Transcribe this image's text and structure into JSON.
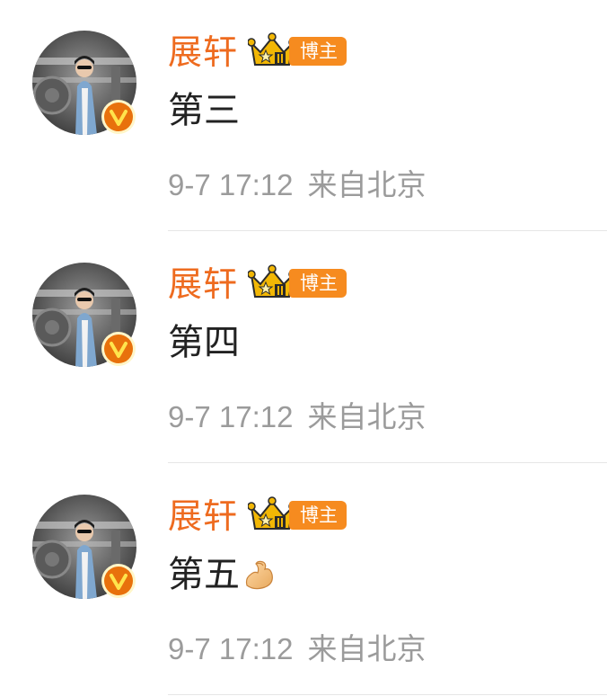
{
  "comments": [
    {
      "username": "展轩",
      "tag": "博主",
      "content": "第三",
      "time": "9-7 17:12",
      "location": "来自北京",
      "emoji": ""
    },
    {
      "username": "展轩",
      "tag": "博主",
      "content": "第四",
      "time": "9-7 17:12",
      "location": "来自北京",
      "emoji": ""
    },
    {
      "username": "展轩",
      "tag": "博主",
      "content": "第五",
      "time": "9-7 17:12",
      "location": "来自北京",
      "emoji": "flexed-biceps-icon"
    }
  ],
  "colors": {
    "username": "#ee6b1f",
    "tag_bg": "#f68b1f",
    "meta": "#9b9b9b",
    "verified": "#e8710c",
    "crown": "#f2b705"
  }
}
